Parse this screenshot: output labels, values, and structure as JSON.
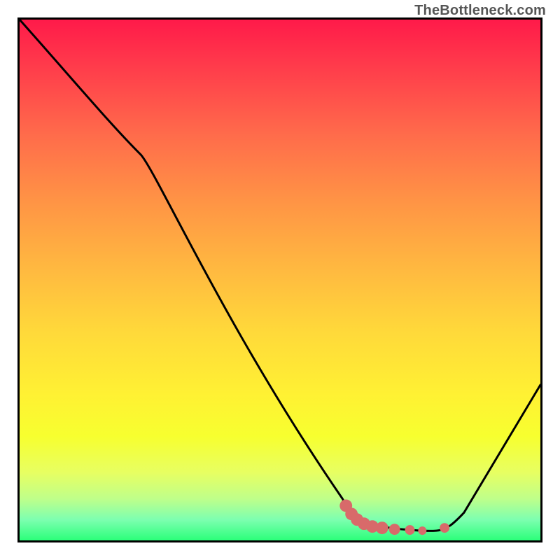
{
  "watermark": "TheBottleneck.com",
  "chart_data": {
    "type": "line",
    "title": "",
    "xlabel": "",
    "ylabel": "",
    "xlim": [
      0,
      100
    ],
    "ylim": [
      0,
      100
    ],
    "series": [
      {
        "name": "curve",
        "color": "#000000",
        "points": [
          {
            "x": 0,
            "y": 100
          },
          {
            "x": 22,
            "y": 78
          },
          {
            "x": 28,
            "y": 71
          },
          {
            "x": 62,
            "y": 8
          },
          {
            "x": 64,
            "y": 5
          },
          {
            "x": 68,
            "y": 3
          },
          {
            "x": 78,
            "y": 2
          },
          {
            "x": 82,
            "y": 1.7
          },
          {
            "x": 85,
            "y": 4
          },
          {
            "x": 100,
            "y": 30
          }
        ]
      }
    ],
    "markers": [
      {
        "x": 63,
        "y": 7,
        "color": "#d86a6a"
      },
      {
        "x": 64,
        "y": 5,
        "color": "#d86a6a"
      },
      {
        "x": 65,
        "y": 3.5,
        "color": "#d86a6a"
      },
      {
        "x": 66,
        "y": 3,
        "color": "#d86a6a"
      },
      {
        "x": 68,
        "y": 2.8,
        "color": "#d86a6a"
      },
      {
        "x": 70,
        "y": 2.6,
        "color": "#d86a6a"
      },
      {
        "x": 73,
        "y": 2.4,
        "color": "#d86a6a"
      },
      {
        "x": 76,
        "y": 2.2,
        "color": "#d86a6a"
      },
      {
        "x": 79,
        "y": 2,
        "color": "#d86a6a"
      },
      {
        "x": 82,
        "y": 2,
        "color": "#d86a6a"
      }
    ],
    "gradient_stops": [
      {
        "offset": 0,
        "color": "#ff1a4a"
      },
      {
        "offset": 10,
        "color": "#ff3f4b"
      },
      {
        "offset": 22,
        "color": "#ff6b4b"
      },
      {
        "offset": 35,
        "color": "#ff9445"
      },
      {
        "offset": 48,
        "color": "#ffb940"
      },
      {
        "offset": 60,
        "color": "#ffd93a"
      },
      {
        "offset": 72,
        "color": "#fff133"
      },
      {
        "offset": 80,
        "color": "#f7ff2f"
      },
      {
        "offset": 87,
        "color": "#e7ff62"
      },
      {
        "offset": 92,
        "color": "#bfff8a"
      },
      {
        "offset": 96,
        "color": "#7dffb0"
      },
      {
        "offset": 100,
        "color": "#2bff7a"
      }
    ]
  }
}
